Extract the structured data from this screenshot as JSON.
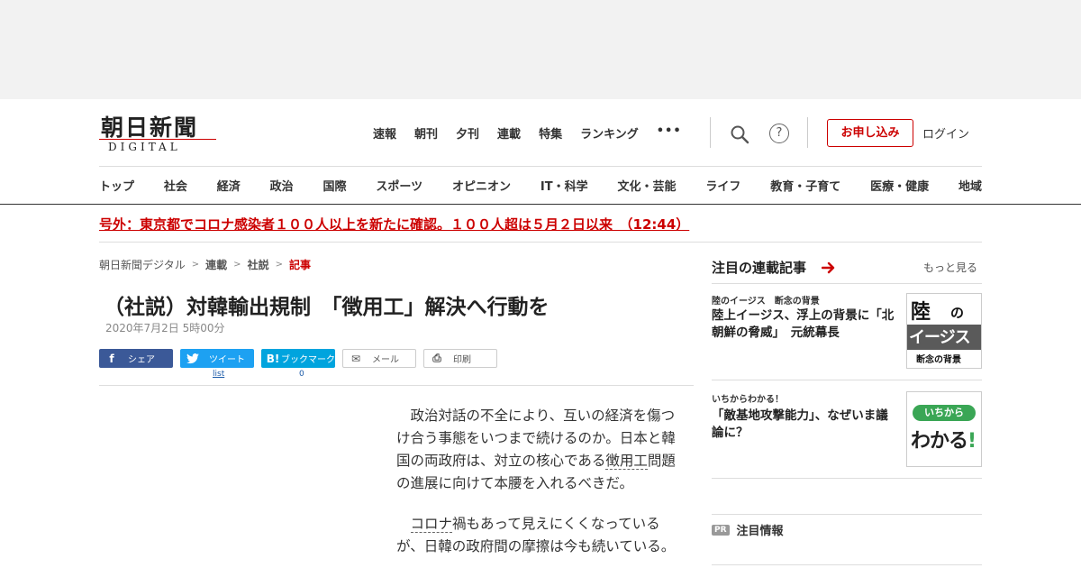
{
  "logo": {
    "main": "朝日新聞",
    "sub": "DIGITAL"
  },
  "topnav": [
    "速報",
    "朝刊",
    "夕刊",
    "連載",
    "特集",
    "ランキング",
    "•••"
  ],
  "header": {
    "subscribe": "お申し込み",
    "login": "ログイン",
    "help": "?"
  },
  "catnav": [
    "トップ",
    "社会",
    "経済",
    "政治",
    "国際",
    "スポーツ",
    "オピニオン",
    "IT・科学",
    "文化・芸能",
    "ライフ",
    "教育・子育て",
    "医療・健康",
    "地域"
  ],
  "breaking": "号外：東京都でコロナ感染者１００人以上を新たに確認。１００人超は５月２日以来　（12:44）",
  "breadcrumb": {
    "home": "朝日新聞デジタル",
    "series": "連載",
    "editorial": "社説",
    "current": "記事",
    "sep": ">"
  },
  "article": {
    "title": "（社説）対韓輸出規制　「徴用工」解決へ行動を",
    "date": "2020年7月2日 5時00分",
    "p1_a": "政治対話の不全により、互いの経済を傷つけ合う事態をいつまで続けるのか。日本と韓国の両政府は、対立の核心である",
    "p1_kw": "徴用工",
    "p1_b": "問題の進展に向けて本腰を入れるべきだ。",
    "p2_kw": "コロナ",
    "p2_a": "禍もあって見えにくくなっているが、日韓の政府間の摩擦は今も続いている。"
  },
  "share": {
    "facebook": "シェア",
    "twitter": "ツイート",
    "hatena": "ブックマーク",
    "mail": "メール",
    "print": "印刷",
    "fb_icon": "f",
    "hatena_icon": "B!",
    "mail_icon": "✉",
    "print_icon": "⎙",
    "twitter_count": "list",
    "hatena_count": "0"
  },
  "sidebar": {
    "heading": "注目の連載記事",
    "more": "もっと見る",
    "cards": [
      {
        "series": "陸のイージス　断念の背景",
        "headline": "陸上イージス、浮上の背景に「北朝鮮の脅威」　元統幕長",
        "thumb": {
          "a": "陸",
          "b": "の",
          "c": "イージス",
          "d": "断念の背景"
        }
      },
      {
        "series": "いちからわかる！",
        "headline": "「敵基地攻撃能力」、なぜいま議論に？",
        "thumb": {
          "pill": "いちから",
          "big": "わかる",
          "bang": "!"
        }
      }
    ],
    "pr_badge": "PR",
    "pr_label": "注目情報"
  },
  "colors": {
    "accent": "#cc0000",
    "facebook": "#3b5998",
    "twitter": "#1da1f2",
    "hatena": "#00a4de",
    "wakaru_green": "#3aa655"
  }
}
